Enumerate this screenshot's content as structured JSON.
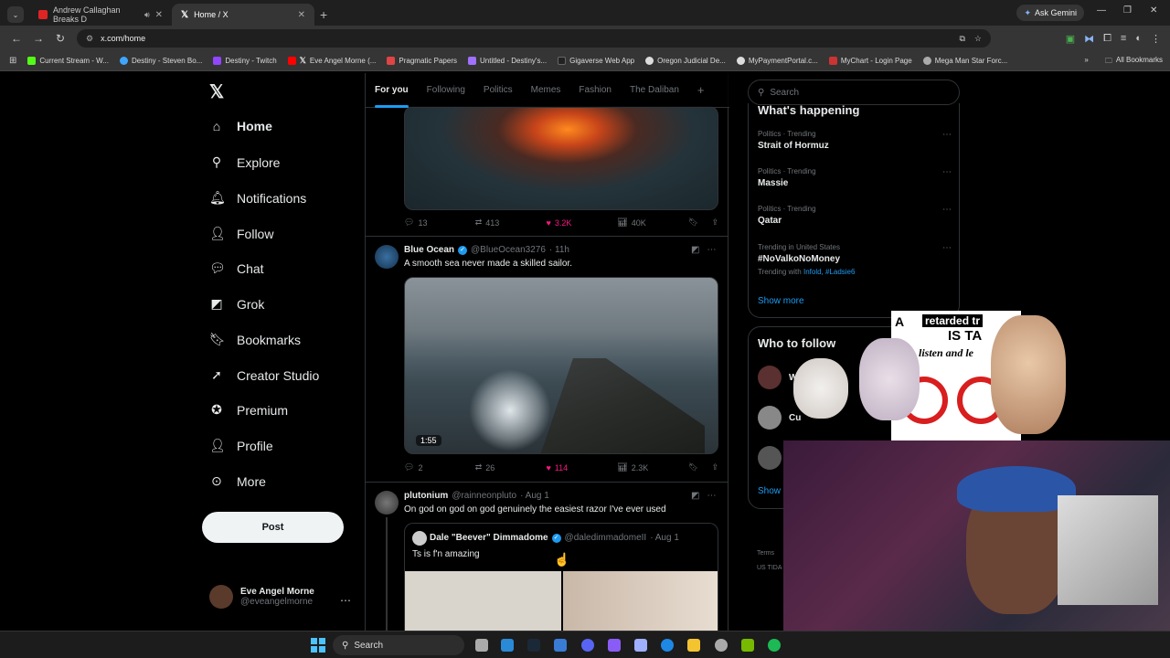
{
  "browser": {
    "tabs": [
      {
        "title": "Andrew Callaghan Breaks D",
        "active": false,
        "favicon_color": "#e02424"
      },
      {
        "title": "Home / X",
        "active": true,
        "favicon_color": "#000000"
      }
    ],
    "ask_gemini": "Ask Gemini",
    "url": "x.com/home",
    "bookmarks": [
      {
        "label": "Current Stream - W...",
        "color": "#53fc18"
      },
      {
        "label": "Destiny - Steven Bo...",
        "color": "#3ea6ff"
      },
      {
        "label": "Destiny - Twitch",
        "color": "#9146ff"
      },
      {
        "label": "Eve Angel Morne (...",
        "color": "#ff0000"
      },
      {
        "label": "Pragmatic Papers",
        "color": "#e04444"
      },
      {
        "label": "Untitled - Destiny's...",
        "color": "#a070ff"
      },
      {
        "label": "Gigaverse Web App",
        "color": "#222222"
      },
      {
        "label": "Oregon Judicial De...",
        "color": "#dddddd"
      },
      {
        "label": "MyPaymentPortal.c...",
        "color": "#dddddd"
      },
      {
        "label": "MyChart - Login Page",
        "color": "#cc3333"
      },
      {
        "label": "Mega Man Star Forc...",
        "color": "#aaaaaa"
      }
    ],
    "all_bookmarks": "All Bookmarks"
  },
  "nav": {
    "items": [
      {
        "label": "Home",
        "icon": "home-icon",
        "glyph": "⌂"
      },
      {
        "label": "Explore",
        "icon": "search-icon",
        "glyph": "⚲"
      },
      {
        "label": "Notifications",
        "icon": "bell-icon",
        "glyph": "🔔︎"
      },
      {
        "label": "Follow",
        "icon": "person-add-icon",
        "glyph": "👤︎"
      },
      {
        "label": "Chat",
        "icon": "chat-icon",
        "glyph": "💬︎"
      },
      {
        "label": "Grok",
        "icon": "grok-icon",
        "glyph": "◩"
      },
      {
        "label": "Bookmarks",
        "icon": "bookmark-icon",
        "glyph": "🔖︎"
      },
      {
        "label": "Creator Studio",
        "icon": "rocket-icon",
        "glyph": "➚"
      },
      {
        "label": "Premium",
        "icon": "verified-icon",
        "glyph": "✪"
      },
      {
        "label": "Profile",
        "icon": "person-icon",
        "glyph": "👤︎"
      },
      {
        "label": "More",
        "icon": "more-circle-icon",
        "glyph": "⋯"
      }
    ],
    "post_button": "Post",
    "account": {
      "name": "Eve Angel Morne",
      "handle": "@eveangelmorne"
    }
  },
  "feed": {
    "tabs": [
      "For you",
      "Following",
      "Politics",
      "Memes",
      "Fashion",
      "The Daliban"
    ],
    "posts": [
      {
        "replies": "13",
        "reposts": "413",
        "likes": "3.2K",
        "views": "40K"
      },
      {
        "name": "Blue Ocean",
        "handle": "@BlueOcean3276",
        "time": "· 11h",
        "text": "A smooth sea never made a skilled sailor.",
        "video_duration": "1:55",
        "replies": "2",
        "reposts": "26",
        "likes": "114",
        "views": "2.3K"
      },
      {
        "name": "plutonium",
        "handle": "@rainneonpluto",
        "time": "· Aug 1",
        "text": "On god on god on god genuinely the easiest razor I've ever used",
        "quote": {
          "name": "Dale \"Beever\" Dimmadome",
          "handle": "@daledimmadomeII",
          "time": "· Aug 1",
          "text": "Ts is f'n amazing"
        }
      }
    ]
  },
  "sidebar": {
    "search_placeholder": "Search",
    "whats_happening": "What's happening",
    "trends": [
      {
        "context": "Politics · Trending",
        "title": "Strait of Hormuz"
      },
      {
        "context": "Politics · Trending",
        "title": "Massie"
      },
      {
        "context": "Politics · Trending",
        "title": "Qatar"
      },
      {
        "context": "Trending in United States",
        "title": "#NoValkoNoMoney",
        "with_prefix": "Trending with",
        "with": "Infold, #Ladsie6"
      }
    ],
    "show_more": "Show more",
    "who_to_follow": "Who to follow",
    "follow_suggestions": [
      "Wo",
      "Cu",
      ""
    ],
    "show": "Show",
    "terms": "Terms",
    "terms2": "US TIDA"
  },
  "overlay": {
    "logo": "A",
    "line1": "retarded tr",
    "line2": "IS TA",
    "line3": "listen and le"
  },
  "taskbar": {
    "search": "Search"
  }
}
